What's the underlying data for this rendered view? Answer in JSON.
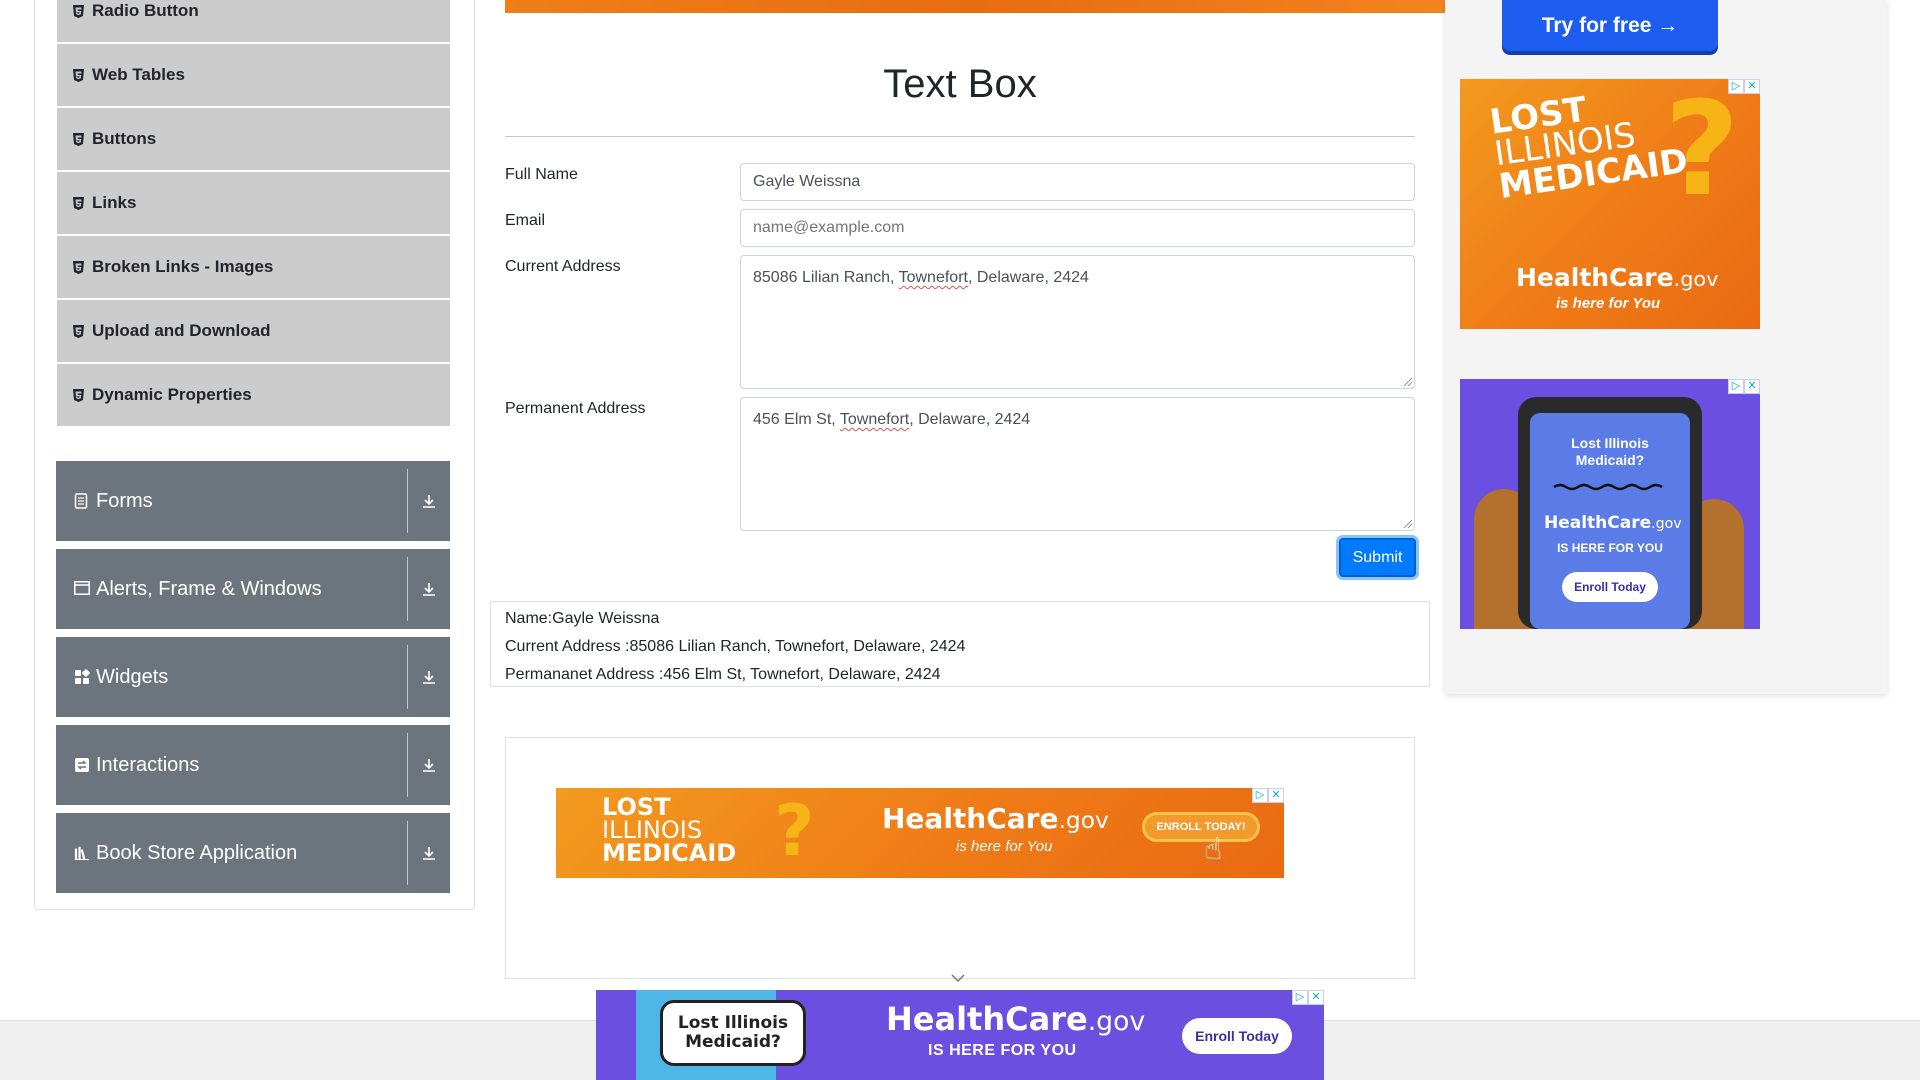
{
  "sidebar": {
    "sub_items": [
      {
        "label": "Radio Button"
      },
      {
        "label": "Web Tables"
      },
      {
        "label": "Buttons"
      },
      {
        "label": "Links"
      },
      {
        "label": "Broken Links - Images"
      },
      {
        "label": "Upload and Download"
      },
      {
        "label": "Dynamic Properties"
      }
    ],
    "groups": [
      {
        "label": "Forms",
        "icon": "document-icon"
      },
      {
        "label": "Alerts, Frame & Windows",
        "icon": "window-icon"
      },
      {
        "label": "Widgets",
        "icon": "widgets-grid-icon"
      },
      {
        "label": "Interactions",
        "icon": "interactions-icon"
      },
      {
        "label": "Book Store Application",
        "icon": "books-icon"
      }
    ]
  },
  "main": {
    "title": "Text Box",
    "form": {
      "full_name_label": "Full Name",
      "full_name_value": "Gayle Weissna",
      "email_label": "Email",
      "email_placeholder": "name@example.com",
      "current_address_label": "Current Address",
      "current_address_value": {
        "before": "85086 Lilian Ranch, ",
        "flagged": "Townefort",
        "after": ", Delaware, 2424"
      },
      "permanent_address_label": "Permanent Address",
      "permanent_address_value": {
        "before": "456 Elm St, ",
        "flagged": "Townefort",
        "after": ", Delaware, 2424"
      },
      "submit_label": "Submit"
    },
    "output": {
      "name_line": "Name:Gayle Weissna",
      "current_line": "Current Address :85086 Lilian Ranch, Townefort, Delaware, 2424",
      "permanent_line": "Permananet Address :456 Elm St, Townefort, Delaware, 2424"
    }
  },
  "ads": {
    "try_button": "Try for free →",
    "lost": [
      "LOST",
      "ILLINOIS",
      "MEDICAID"
    ],
    "healthcare": "HealthCare",
    "gov": ".gov",
    "here_for_you": "is here for You",
    "enroll_today_caps": "ENROLL TODAY!",
    "lost_medicaid_q": "Lost Illinois Medicaid?",
    "here_for_you_caps": "IS HERE FOR YOU",
    "enroll_today": "Enroll Today",
    "colors": {
      "orange": "#ef7b17",
      "purple": "#6b4fe0",
      "button_blue": "#1d5ef0"
    }
  },
  "colors": {
    "submit": "#007bff",
    "sidebar_group": "#6c757d",
    "sidebar_item": "#cccccc"
  }
}
